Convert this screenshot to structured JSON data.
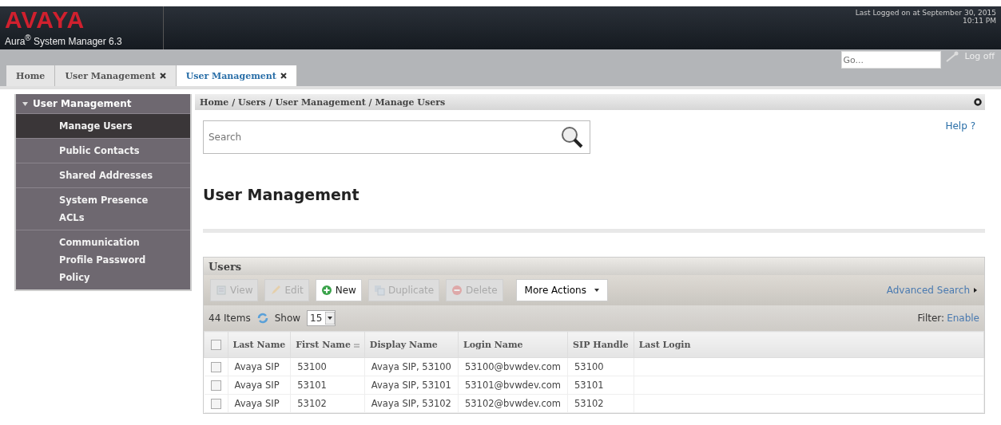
{
  "header": {
    "logo": "AVAYA",
    "product": "Aura",
    "product_mark": "®",
    "product_name": "System Manager 6.3",
    "last_logged": "Last Logged on at September 30, 2015",
    "time": "10:11 PM",
    "go_placeholder": "Go...",
    "logoff": "Log off"
  },
  "tabs": [
    {
      "label": "Home",
      "selected": false,
      "closable": false
    },
    {
      "label": "User Management",
      "selected": false,
      "closable": true
    },
    {
      "label": "User Management",
      "selected": true,
      "closable": true
    }
  ],
  "sidebar": {
    "title": "User Management",
    "expanded": true,
    "items": [
      {
        "label": "Manage Users",
        "selected": true
      },
      {
        "label": "Public Contacts",
        "selected": false
      },
      {
        "label": "Shared Addresses",
        "selected": false
      },
      {
        "label": "System Presence\nACLs",
        "selected": false
      },
      {
        "label": "Communication\nProfile Password\nPolicy",
        "selected": false
      }
    ]
  },
  "breadcrumb": "Home / Users / User Management / Manage Users",
  "search": {
    "placeholder": "Search"
  },
  "help": "Help ?",
  "page_title": "User Management",
  "panel": {
    "title": "Users",
    "toolbar": [
      {
        "label": "View",
        "disabled": true
      },
      {
        "label": "Edit",
        "disabled": true
      },
      {
        "label": "New",
        "disabled": false
      },
      {
        "label": "Duplicate",
        "disabled": true
      },
      {
        "label": "Delete",
        "disabled": true
      }
    ],
    "more_actions": "More Actions",
    "advanced_search": "Advanced Search",
    "items_count": "44 Items",
    "show_label": "Show",
    "show_value": "15",
    "filter_label": "Filter:",
    "filter_link": "Enable",
    "select_all_checked": false,
    "columns": [
      {
        "label": "Last Name",
        "sorted": false
      },
      {
        "label": "First Name",
        "sorted": true
      },
      {
        "label": "Display Name",
        "sorted": false
      },
      {
        "label": "Login Name",
        "sorted": false
      },
      {
        "label": "SIP Handle",
        "sorted": false
      },
      {
        "label": "Last Login",
        "sorted": false
      }
    ],
    "rows": [
      {
        "checked": false,
        "cells": [
          "Avaya SIP",
          "53100",
          "Avaya SIP, 53100",
          "53100@bvwdev.com",
          "53100"
        ]
      },
      {
        "checked": false,
        "cells": [
          "Avaya SIP",
          "53101",
          "Avaya SIP, 53101",
          "53101@bvwdev.com",
          "53101"
        ]
      },
      {
        "checked": false,
        "cells": [
          "Avaya SIP",
          "53102",
          "Avaya SIP, 53102",
          "53102@bvwdev.com",
          "53102"
        ]
      }
    ]
  }
}
